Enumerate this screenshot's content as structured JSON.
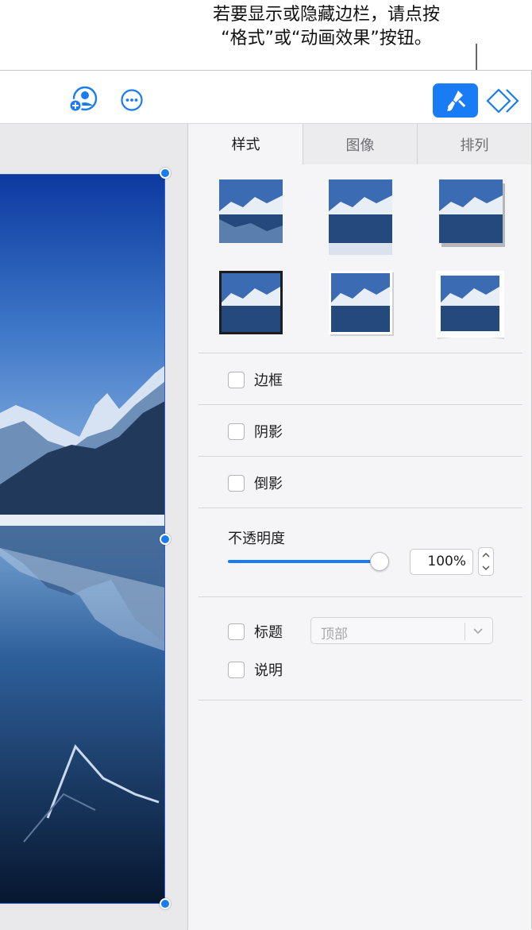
{
  "callout": {
    "line1": "若要显示或隐藏边栏，请点按",
    "line2": "“格式”或“动画效果”按钮。"
  },
  "toolbar": {
    "icons": [
      "collaborate-icon",
      "more-icon",
      "format-paintbrush-icon",
      "animate-diamond-icon"
    ],
    "accent": "#1a7cf5"
  },
  "sidebar": {
    "tabs": [
      {
        "label": "样式",
        "active": true
      },
      {
        "label": "图像",
        "active": false
      },
      {
        "label": "排列",
        "active": false
      }
    ],
    "options": {
      "border": "边框",
      "shadow": "阴影",
      "reflection": "倒影"
    },
    "opacity": {
      "label": "不透明度",
      "value": "100%",
      "level": 1.0
    },
    "caption": {
      "title_label": "标题",
      "position": "顶部",
      "description_label": "说明"
    }
  }
}
